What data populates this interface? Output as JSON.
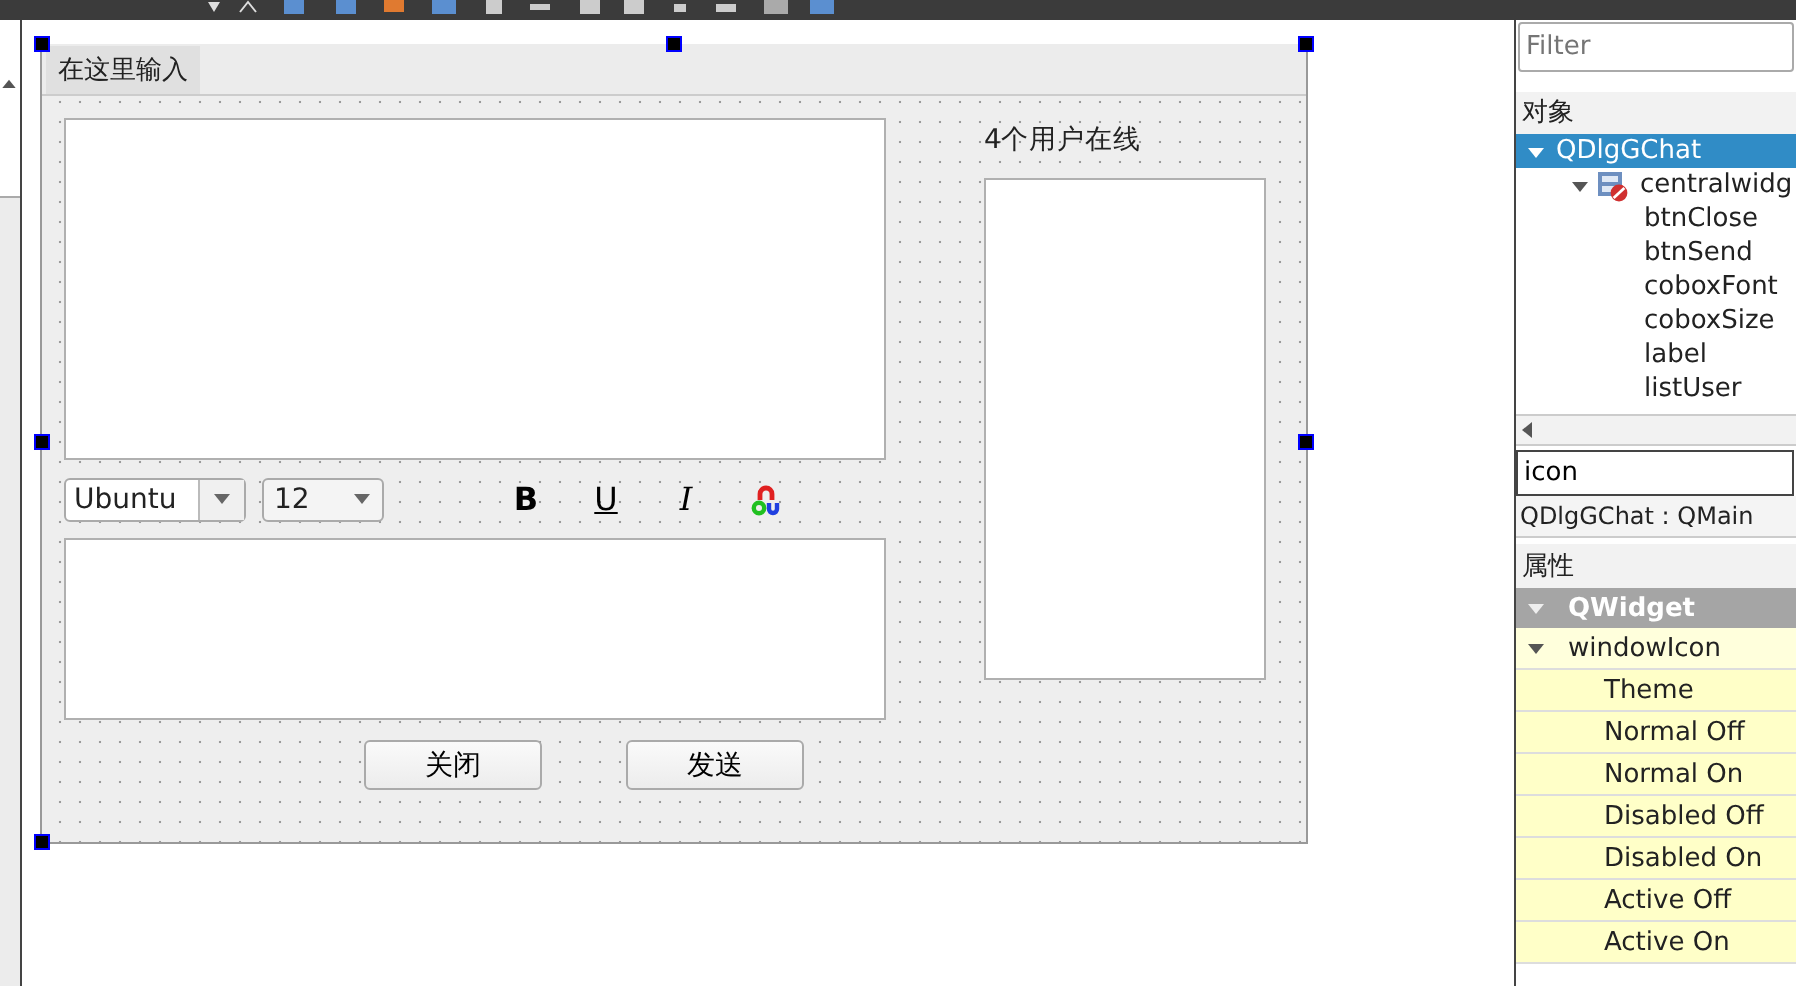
{
  "form": {
    "menu_bar": {
      "placeholder_item": "在这里输入"
    },
    "font_combo": {
      "value": "Ubuntu"
    },
    "size_combo": {
      "value": "12"
    },
    "format_buttons": [
      {
        "kind": "bold",
        "label": "B"
      },
      {
        "kind": "underline",
        "label": "U"
      },
      {
        "kind": "italic",
        "label": "I"
      },
      {
        "kind": "color"
      }
    ],
    "online_label": "4个用户在线",
    "buttons": [
      "关闭",
      "发送"
    ]
  },
  "object_inspector": {
    "filter": {
      "placeholder": "Filter"
    },
    "header": "对象",
    "items": [
      {
        "label": "QDlgGChat",
        "selected": true,
        "expanded": true,
        "children": [
          {
            "label": "centralwidg",
            "selected": false,
            "expanded": true,
            "kind": "widget",
            "children": [
              {
                "label": "btnClose",
                "selected": false
              },
              {
                "label": "btnSend",
                "selected": false
              },
              {
                "label": "coboxFont",
                "selected": false
              },
              {
                "label": "coboxSize",
                "selected": false
              },
              {
                "label": "label",
                "selected": false
              },
              {
                "label": "listUser",
                "selected": false
              }
            ]
          }
        ]
      }
    ]
  },
  "property_editor": {
    "filter": {
      "value": "icon"
    },
    "class_label": "QDlgGChat : QMain",
    "header": "属性",
    "groups": [
      {
        "label": "QWidget",
        "expanded": true,
        "properties": [
          {
            "label": "windowIcon",
            "expanded": true,
            "children": [
              "Theme",
              "Normal Off",
              "Normal On",
              "Disabled Off",
              "Disabled On",
              "Active Off",
              "Active On"
            ]
          }
        ]
      }
    ]
  }
}
